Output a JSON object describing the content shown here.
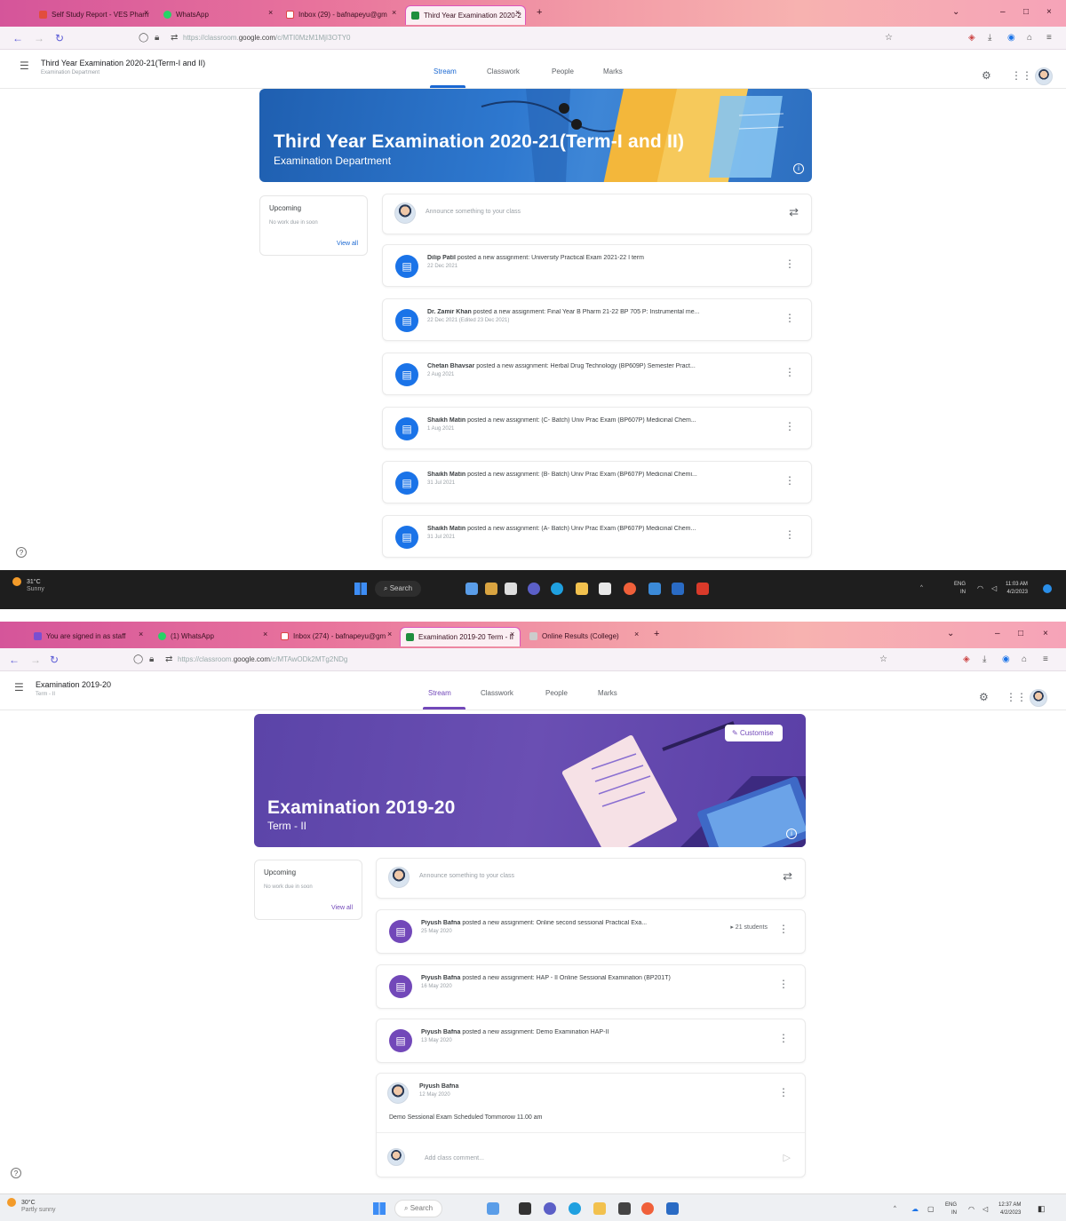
{
  "window1": {
    "tabs": [
      {
        "label": "Self Study Report - VES Pharm"
      },
      {
        "label": "WhatsApp"
      },
      {
        "label": "Inbox (29) - bafnapeyu@gm"
      },
      {
        "label": "Third Year Examination 2020-2"
      }
    ],
    "url": {
      "faded": "https://classroom.",
      "domain": "google.com",
      "path": "/c/MTI0MzM1MjI3OTY0"
    },
    "classroom": {
      "class_title": "Third Year Examination 2020-21(Term-I and II)",
      "class_subtitle": "Examination Department",
      "tabs": [
        "Stream",
        "Classwork",
        "People",
        "Marks"
      ],
      "banner_title": "Third Year Examination 2020-21(Term-I and II)",
      "banner_subtitle": "Examination Department",
      "upcoming": {
        "title": "Upcoming",
        "text": "No work due in soon",
        "link": "View all"
      },
      "announce_placeholder": "Announce something to your class",
      "posts": [
        {
          "author": "Dilip Patil",
          "action": "posted a new assignment:",
          "title": "University Practical Exam 2021-22 I term",
          "date": "22 Dec 2021"
        },
        {
          "author": "Dr. Zamir Khan",
          "action": "posted a new assignment:",
          "title": "Final Year B Pharm 21-22 BP 705 P: Instrumental me...",
          "date": "22 Dec 2021 (Edited 23 Dec 2021)"
        },
        {
          "author": "Chetan Bhavsar",
          "action": "posted a new assignment:",
          "title": "Herbal Drug Technology (BP609P) Semester Pract...",
          "date": "2 Aug 2021"
        },
        {
          "author": "Shaikh Matin",
          "action": "posted a new assignment:",
          "title": "(C- Batch) Univ Prac Exam (BP607P) Medicinal Chem...",
          "date": "1 Aug 2021"
        },
        {
          "author": "Shaikh Matin",
          "action": "posted a new assignment:",
          "title": "(B- Batch) Univ Prac Exam (BP607P) Medicinal Chemi...",
          "date": "31 Jul 2021"
        },
        {
          "author": "Shaikh Matin",
          "action": "posted a new assignment:",
          "title": "(A- Batch) Univ Prac Exam (BP607P) Medicinal Chem...",
          "date": "31 Jul 2021"
        }
      ]
    },
    "taskbar": {
      "temp": "31°C",
      "condition": "Sunny",
      "search": "Search",
      "lang": "ENG",
      "region": "IN",
      "time": "11:03 AM",
      "date": "4/2/2023"
    }
  },
  "window2": {
    "tabs": [
      {
        "label": "You are signed in as staff"
      },
      {
        "label": "(1) WhatsApp"
      },
      {
        "label": "Inbox (274) - bafnapeyu@gm"
      },
      {
        "label": "Examination 2019-20 Term - II"
      },
      {
        "label": "Online Results (College)"
      }
    ],
    "url": {
      "faded": "https://classroom.",
      "domain": "google.com",
      "path": "/c/MTAwODk2MTg2NDg"
    },
    "classroom": {
      "class_title": "Examination 2019-20",
      "class_subtitle": "Term - II",
      "tabs": [
        "Stream",
        "Classwork",
        "People",
        "Marks"
      ],
      "banner_title": "Examination 2019-20",
      "banner_subtitle": "Term - II",
      "customize_label": "Customise",
      "upcoming": {
        "title": "Upcoming",
        "text": "No work due in soon",
        "link": "View all"
      },
      "announce_placeholder": "Announce something to your class",
      "posts": [
        {
          "author": "Piyush Bafna",
          "action": "posted a new assignment:",
          "title": "Online second sessional Practical Exa...",
          "date": "25 May 2020",
          "students": "21 students"
        },
        {
          "author": "Piyush Bafna",
          "action": "posted a new assignment:",
          "title": "HAP - II Online Sessional Examination (BP201T)",
          "date": "16 May 2020"
        },
        {
          "author": "Piyush Bafna",
          "action": "posted a new assignment:",
          "title": "Demo Examination HAP-II",
          "date": "13 May 2020"
        }
      ],
      "announcement": {
        "author": "Piyush Bafna",
        "date": "12 May 2020",
        "text": "Demo Sessional Exam Scheduled Tommorow 11.00 am",
        "comment_placeholder": "Add class comment..."
      }
    },
    "taskbar": {
      "temp": "30°C",
      "condition": "Partly sunny",
      "search": "Search",
      "lang": "ENG",
      "region": "IN",
      "time": "12:37 AM",
      "date": "4/2/2023"
    }
  },
  "colors": {
    "banner1": "#2d6fc0",
    "banner2": "#6a4fb3",
    "assignment_blue": "#1a73e8",
    "assignment_purple": "#7248b9",
    "tab_active_blue": "#1967d2",
    "taskbar_dark": "#1e1e1e"
  },
  "icons": [
    "menu-icon",
    "settings-icon",
    "apps-grid-icon",
    "repost-icon",
    "assignment-icon",
    "kebab-icon",
    "info-icon",
    "help-icon",
    "pencil-icon",
    "send-icon",
    "star-icon",
    "download-icon",
    "windows-start-icon",
    "search-icon",
    "wifi-icon",
    "volume-icon"
  ]
}
